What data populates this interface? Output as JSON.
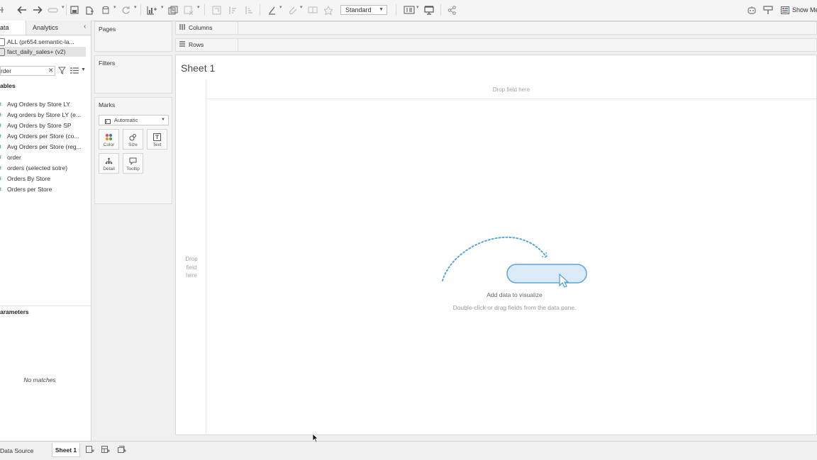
{
  "toolbar": {
    "standard_select": "Standard",
    "show_me": "Show Me",
    "icons": [
      "back-icon",
      "forward-icon",
      "redo-icon",
      "save-icon",
      "new-datasource-icon",
      "pause-updates-icon",
      "refresh-icon",
      "new-worksheet-icon",
      "duplicate-icon",
      "clear-icon",
      "swap-icon",
      "sort-ascending-icon",
      "sort-descending-icon",
      "highlight-icon",
      "group-icon",
      "labels-icon",
      "fix-axes-icon",
      "fit-icon",
      "presentation-icon",
      "share-icon",
      "tableau-bot-icon",
      "format-icon",
      "show-me-icon"
    ]
  },
  "data_pane": {
    "tab_data": "ata",
    "tab_analytics": "Analytics",
    "datasources": [
      "ALL (pr654.semantic-la...",
      "fact_daily_sales+ (v2)"
    ],
    "search_value": "rder",
    "tables_heading": "ables",
    "fields": [
      "Avg Orders by Store LY",
      "Avg orders by Store LY (e...",
      "Avg Orders by Store SP",
      "Avg Orders per Store (co...",
      "Avg Orders per Store (reg...",
      "order",
      "orders  (selected sotre)",
      "Orders By Store",
      "Orders per Store"
    ],
    "parameters_heading": "arameters",
    "no_matches": "No matches"
  },
  "cards": {
    "pages": "Pages",
    "filters": "Filters",
    "marks": "Marks",
    "mark_type": "Automatic",
    "buttons": {
      "color": "Color",
      "size": "Size",
      "text": "Text",
      "detail": "Detail",
      "tooltip": "Tooltip"
    }
  },
  "shelves": {
    "columns": "Columns",
    "rows": "Rows"
  },
  "viz": {
    "sheet_title": "Sheet 1",
    "drop_field_cols": "Drop field here",
    "drop_field_rows": "Drop field here",
    "hint_title": "Add data to visualize",
    "hint_sub": "Double-click or drag fields from the data pane."
  },
  "bottom": {
    "data_source_tab": "Data Source",
    "sheet_tab": "Sheet 1"
  },
  "colors": {
    "accent_blue": "#5aa7d6",
    "measure_green": "#2e9b78"
  }
}
